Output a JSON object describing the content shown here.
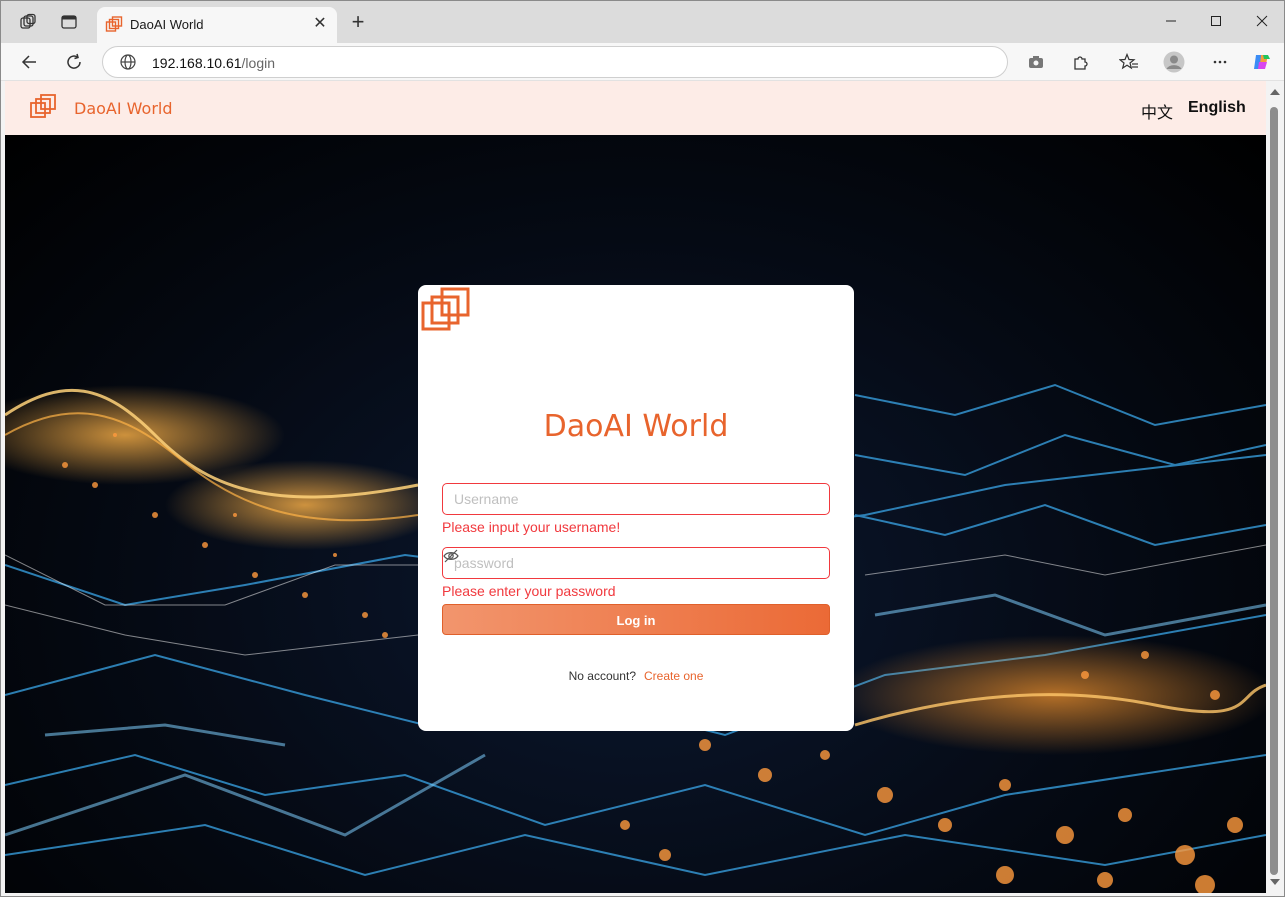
{
  "browser": {
    "tab_title": "DaoAI World",
    "url_host": "192.168.10.61",
    "url_path": "/login"
  },
  "header": {
    "brand": "DaoAI World",
    "lang_zh": "中文",
    "lang_en": "English"
  },
  "login": {
    "title": "DaoAI World",
    "username_placeholder": "Username",
    "username_error": "Please input your username!",
    "password_placeholder": "password",
    "password_error": "Please enter your password",
    "login_label": "Log in",
    "no_account": "No account?",
    "create_link": "Create one"
  },
  "colors": {
    "brand": "#e8642d",
    "error": "#f1393e",
    "header_bg": "#fdece7"
  }
}
